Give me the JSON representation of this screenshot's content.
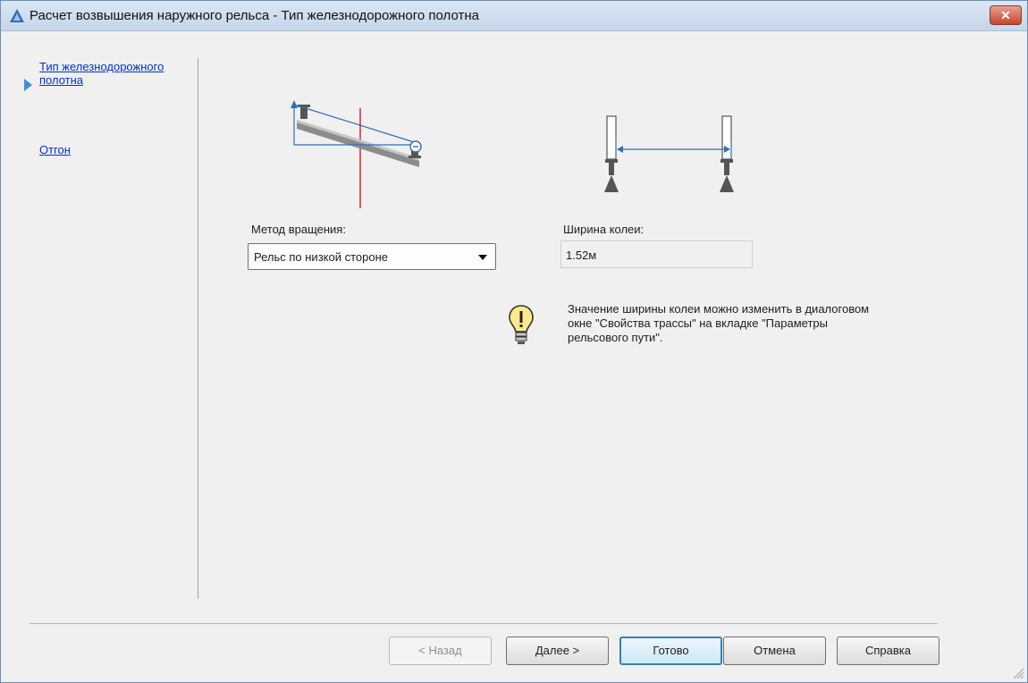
{
  "window": {
    "title": "Расчет возвышения наружного рельса - Тип железнодорожного полотна",
    "close_icon": "close-x-icon"
  },
  "sidebar": {
    "items": [
      {
        "label": "Тип железнодорожного полотна",
        "active": true
      },
      {
        "label": "Отгон",
        "active": false
      }
    ]
  },
  "main": {
    "rotation_method_label": "Метод вращения:",
    "rotation_method_value": "Рельс по низкой стороне",
    "track_gauge_label": "Ширина колеи:",
    "track_gauge_value": "1.52м",
    "info_icon": "lightbulb-icon",
    "info_text": "Значение ширины колеи можно изменить в диалоговом окне \"Свойства трассы\" на вкладке \"Параметры рельсового пути\"."
  },
  "buttons": {
    "back": "< Назад",
    "next": "Далее >",
    "finish": "Готово",
    "cancel": "Отмена",
    "help": "Справка"
  },
  "colors": {
    "link": "#0033cc",
    "nav_arrow": "#3a8ee6",
    "diagram_blue": "#2f6fb7",
    "diagram_red": "#e0282d"
  }
}
